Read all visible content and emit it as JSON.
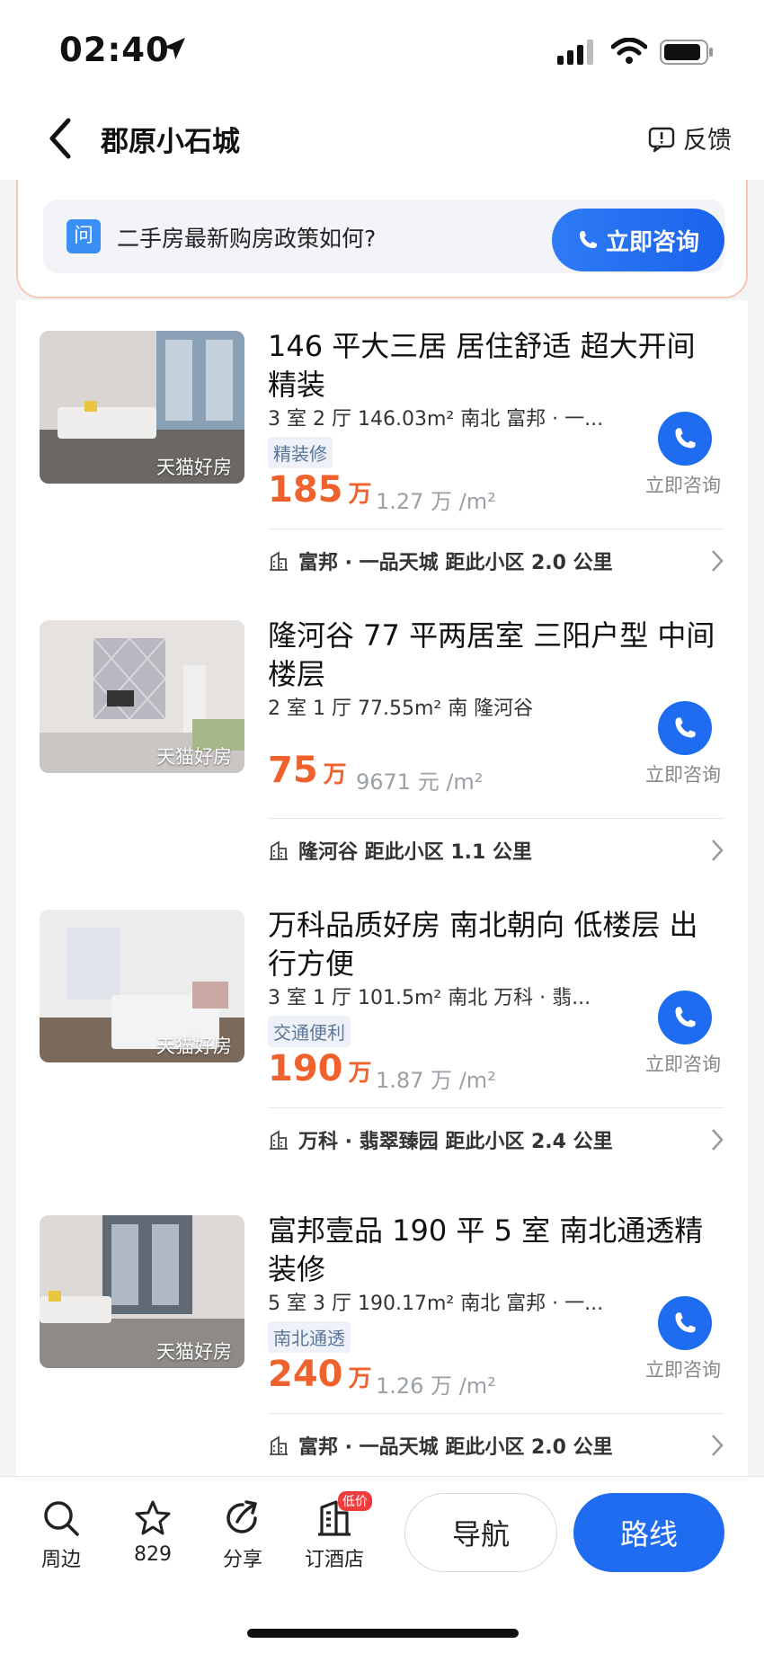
{
  "status": {
    "time": "02:40"
  },
  "nav": {
    "title": "郡原小石城",
    "feedback": "反馈"
  },
  "promo": {
    "badge": "问",
    "question": "二手房最新购房政策如何?",
    "button": "立即咨询"
  },
  "listings": [
    {
      "title": "146 平大三居 居住舒适 超大开间 精装",
      "specs": "3 室 2 厅  146.03m²  南北  富邦 · 一...",
      "tag": "精装修",
      "price": "185",
      "price_unit": "万",
      "unit_price": "1.27 万 /m²",
      "thumb_tag": "天猫好房",
      "call_label": "立即咨询",
      "nearby": "富邦 · 一品天城  距此小区 2.0 公里"
    },
    {
      "title": "隆河谷 77 平两居室 三阳户型 中间楼层",
      "specs": "2 室 1 厅  77.55m²  南  隆河谷",
      "tag": "",
      "price": "75",
      "price_unit": "万",
      "unit_price": "9671 元 /m²",
      "thumb_tag": "天猫好房",
      "call_label": "立即咨询",
      "nearby": "隆河谷  距此小区 1.1 公里"
    },
    {
      "title": "万科品质好房 南北朝向 低楼层 出行方便",
      "specs": "3 室 1 厅  101.5m²  南北  万科 · 翡...",
      "tag": "交通便利",
      "price": "190",
      "price_unit": "万",
      "unit_price": "1.87 万 /m²",
      "thumb_tag": "天猫好房",
      "call_label": "立即咨询",
      "nearby": "万科 · 翡翠臻园  距此小区 2.4 公里"
    },
    {
      "title": "富邦壹品 190 平 5 室 南北通透精装修",
      "specs": "5 室 3 厅  190.17m²  南北  富邦 · 一...",
      "tag": "南北通透",
      "price": "240",
      "price_unit": "万",
      "unit_price": "1.26 万 /m²",
      "thumb_tag": "天猫好房",
      "call_label": "立即咨询",
      "nearby": "富邦 · 一品天城  距此小区 2.0 公里"
    }
  ],
  "bottombar": {
    "nearby": "周边",
    "favorites": "829",
    "share": "分享",
    "hotel": "订酒店",
    "hotel_badge": "低价",
    "navigate": "导航",
    "route": "路线"
  },
  "colors": {
    "accent_blue": "#1f6cf0",
    "price_orange": "#f0622d"
  }
}
